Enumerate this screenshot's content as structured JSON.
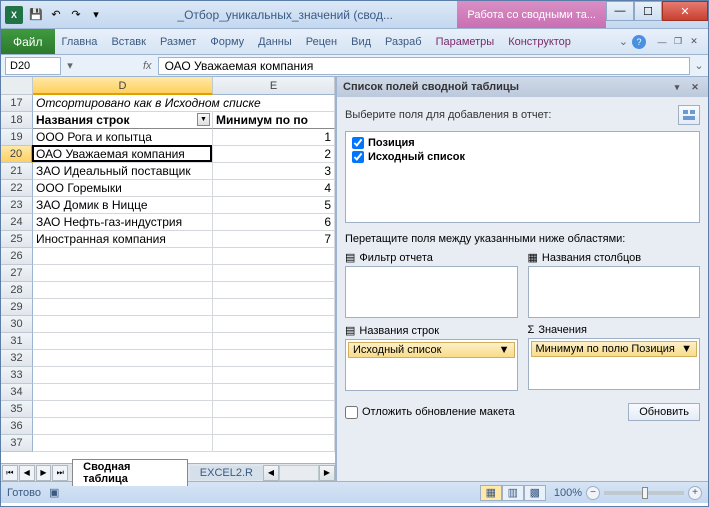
{
  "titlebar": {
    "doc_name": "_Отбор_уникальных_значений (свод...",
    "context_tab": "Работа со сводными та..."
  },
  "ribbon": {
    "file": "Файл",
    "tabs": [
      "Главна",
      "Вставк",
      "Размет",
      "Форму",
      "Данны",
      "Рецен",
      "Вид",
      "Разраб"
    ],
    "ctx_tabs": [
      "Параметры",
      "Конструктор"
    ]
  },
  "fbar": {
    "namebox": "D20",
    "formula": "ОАО Уважаемая компания"
  },
  "grid": {
    "cols": [
      "D",
      "E"
    ],
    "active_col": "D",
    "active_row": "20",
    "rows": [
      {
        "n": "17",
        "d": "Отсортировано как в Исходном списке",
        "e": "",
        "ital": true,
        "span": true
      },
      {
        "n": "18",
        "d": "Названия строк",
        "e": "Минимум по по",
        "head": true,
        "dd": true
      },
      {
        "n": "19",
        "d": "ООО Рога и копытца",
        "e": "1"
      },
      {
        "n": "20",
        "d": "ОАО Уважаемая компания",
        "e": "2",
        "active": true
      },
      {
        "n": "21",
        "d": "ЗАО Идеальный поставщик",
        "e": "3"
      },
      {
        "n": "22",
        "d": "ООО Горемыки",
        "e": "4"
      },
      {
        "n": "23",
        "d": "ЗАО Домик в Ницце",
        "e": "5"
      },
      {
        "n": "24",
        "d": "ЗАО Нефть-газ-индустрия",
        "e": "6"
      },
      {
        "n": "25",
        "d": "Иностранная компания",
        "e": "7"
      },
      {
        "n": "26",
        "d": "",
        "e": ""
      },
      {
        "n": "27",
        "d": "",
        "e": ""
      },
      {
        "n": "28",
        "d": "",
        "e": ""
      },
      {
        "n": "29",
        "d": "",
        "e": ""
      },
      {
        "n": "30",
        "d": "",
        "e": ""
      },
      {
        "n": "31",
        "d": "",
        "e": ""
      },
      {
        "n": "32",
        "d": "",
        "e": ""
      },
      {
        "n": "33",
        "d": "",
        "e": ""
      },
      {
        "n": "34",
        "d": "",
        "e": ""
      },
      {
        "n": "35",
        "d": "",
        "e": ""
      },
      {
        "n": "36",
        "d": "",
        "e": ""
      },
      {
        "n": "37",
        "d": "",
        "e": ""
      }
    ]
  },
  "sheets": {
    "active": "Сводная таблица",
    "next": "EXCEL2.R"
  },
  "taskpane": {
    "title": "Список полей сводной таблицы",
    "choose_lbl": "Выберите поля для добавления в отчет:",
    "fields": [
      {
        "name": "Позиция",
        "checked": true
      },
      {
        "name": "Исходный список",
        "checked": true
      }
    ],
    "drag_lbl": "Перетащите поля между указанными ниже областями:",
    "areas": {
      "filter": "Фильтр отчета",
      "cols": "Названия столбцов",
      "rows": "Названия строк",
      "vals": "Значения"
    },
    "row_items": [
      "Исходный список"
    ],
    "val_items": [
      "Минимум по полю Позиция"
    ],
    "defer": "Отложить обновление макета",
    "update": "Обновить"
  },
  "status": {
    "ready": "Готово",
    "zoom": "100%"
  }
}
